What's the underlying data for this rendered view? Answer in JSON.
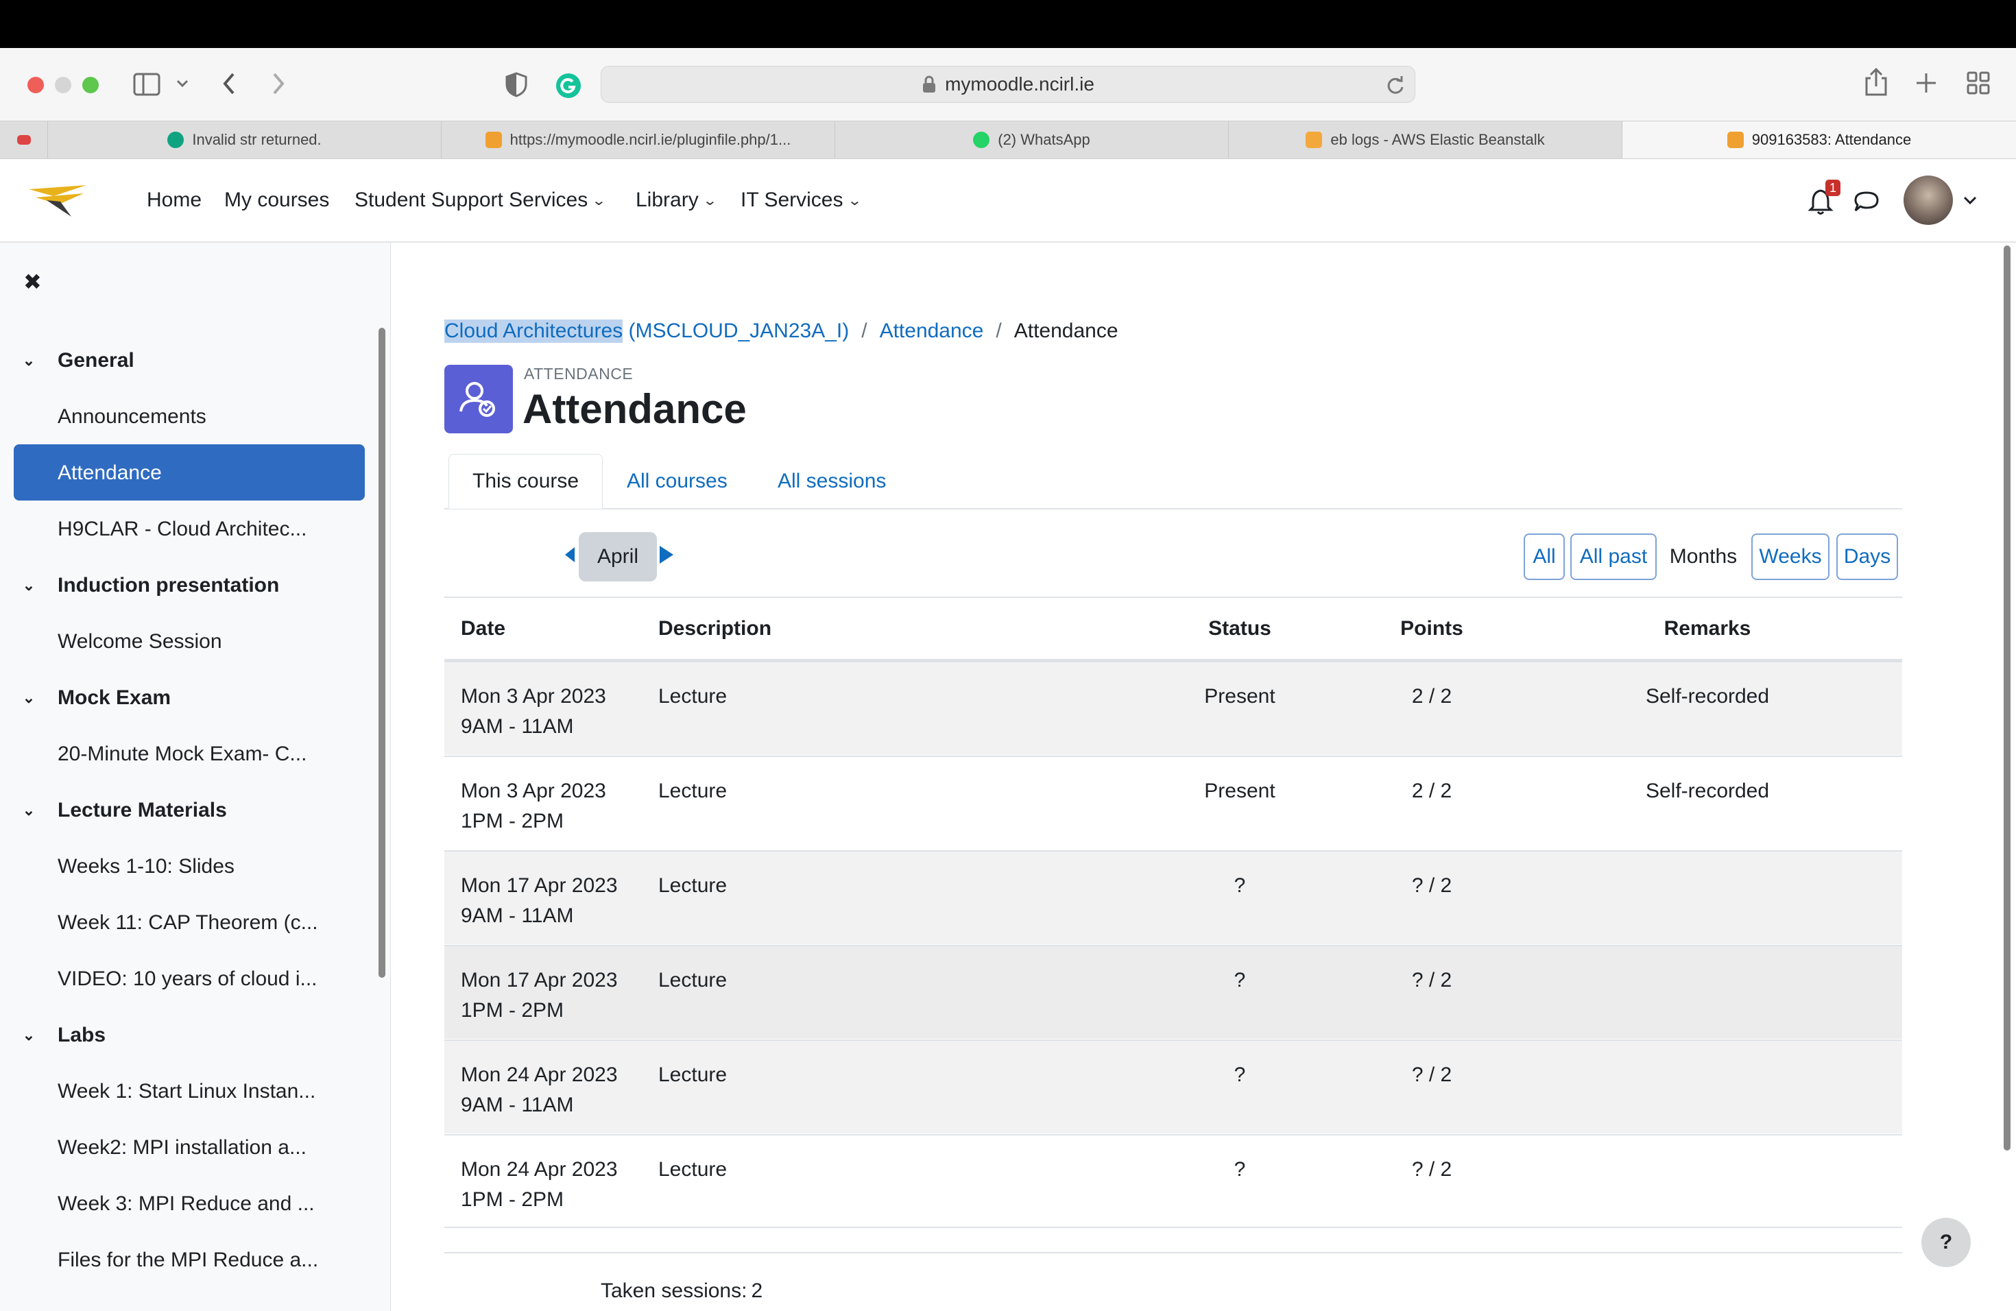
{
  "browser": {
    "url": "mymoodle.ncirl.ie",
    "tabs": [
      {
        "label": "Invalid str returned.",
        "active": false
      },
      {
        "label": "https://mymoodle.ncirl.ie/pluginfile.php/1...",
        "active": false
      },
      {
        "label": "(2) WhatsApp",
        "active": false
      },
      {
        "label": "eb logs - AWS Elastic Beanstalk",
        "active": false
      },
      {
        "label": "909163583: Attendance",
        "active": true
      }
    ]
  },
  "navbar": {
    "links": [
      "Home",
      "My courses",
      "Student Support Services",
      "Library",
      "IT Services"
    ],
    "notification_count": "1"
  },
  "sidebar": {
    "close_glyph": "✖",
    "sections": [
      {
        "title": "General",
        "items": [
          "Announcements",
          "Attendance",
          "H9CLAR - Cloud Architec..."
        ]
      },
      {
        "title": "Induction presentation",
        "items": [
          "Welcome Session"
        ]
      },
      {
        "title": "Mock Exam",
        "items": [
          "20-Minute Mock Exam- C..."
        ]
      },
      {
        "title": "Lecture Materials",
        "items": [
          "Weeks 1-10: Slides",
          "Week 11: CAP Theorem (c...",
          "VIDEO: 10 years of cloud i..."
        ]
      },
      {
        "title": "Labs",
        "items": [
          "Week 1: Start Linux Instan...",
          "Week2: MPI installation a...",
          "Week 3: MPI Reduce and ...",
          "Files for the MPI Reduce a..."
        ]
      }
    ]
  },
  "breadcrumb": {
    "course_highlight": "Cloud Architectures",
    "course_rest": " (MSCLOUD_JAN23A_I)",
    "sep": "/",
    "item2": "Attendance",
    "current": "Attendance"
  },
  "header": {
    "kicker": "ATTENDANCE",
    "title": "Attendance"
  },
  "tabs": [
    "This course",
    "All courses",
    "All sessions"
  ],
  "period": {
    "current": "April",
    "views": [
      "All",
      "All past",
      "Months",
      "Weeks",
      "Days"
    ],
    "selected_view": "Months"
  },
  "table": {
    "columns": [
      "Date",
      "Description",
      "Status",
      "Points",
      "Remarks"
    ],
    "rows": [
      {
        "date": "Mon 3 Apr 2023",
        "time": "9AM - 11AM",
        "description": "Lecture",
        "status": "Present",
        "points": "2 / 2",
        "remarks": "Self-recorded"
      },
      {
        "date": "Mon 3 Apr 2023",
        "time": "1PM - 2PM",
        "description": "Lecture",
        "status": "Present",
        "points": "2 / 2",
        "remarks": "Self-recorded"
      },
      {
        "date": "Mon 17 Apr 2023",
        "time": "9AM - 11AM",
        "description": "Lecture",
        "status": "?",
        "points": "? / 2",
        "remarks": ""
      },
      {
        "date": "Mon 17 Apr 2023",
        "time": "1PM - 2PM",
        "description": "Lecture",
        "status": "?",
        "points": "? / 2",
        "remarks": ""
      },
      {
        "date": "Mon 24 Apr 2023",
        "time": "9AM - 11AM",
        "description": "Lecture",
        "status": "?",
        "points": "? / 2",
        "remarks": ""
      },
      {
        "date": "Mon 24 Apr 2023",
        "time": "1PM - 2PM",
        "description": "Lecture",
        "status": "?",
        "points": "? / 2",
        "remarks": ""
      }
    ]
  },
  "summary": {
    "taken_label": "Taken sessions:",
    "taken_value": "2"
  },
  "help_glyph": "?",
  "colors": {
    "link": "#0f6cbf",
    "active_nav": "#2f6bc0",
    "attendance_icon_bg": "#5b5fd6",
    "notification_badge": "#c9302c"
  }
}
